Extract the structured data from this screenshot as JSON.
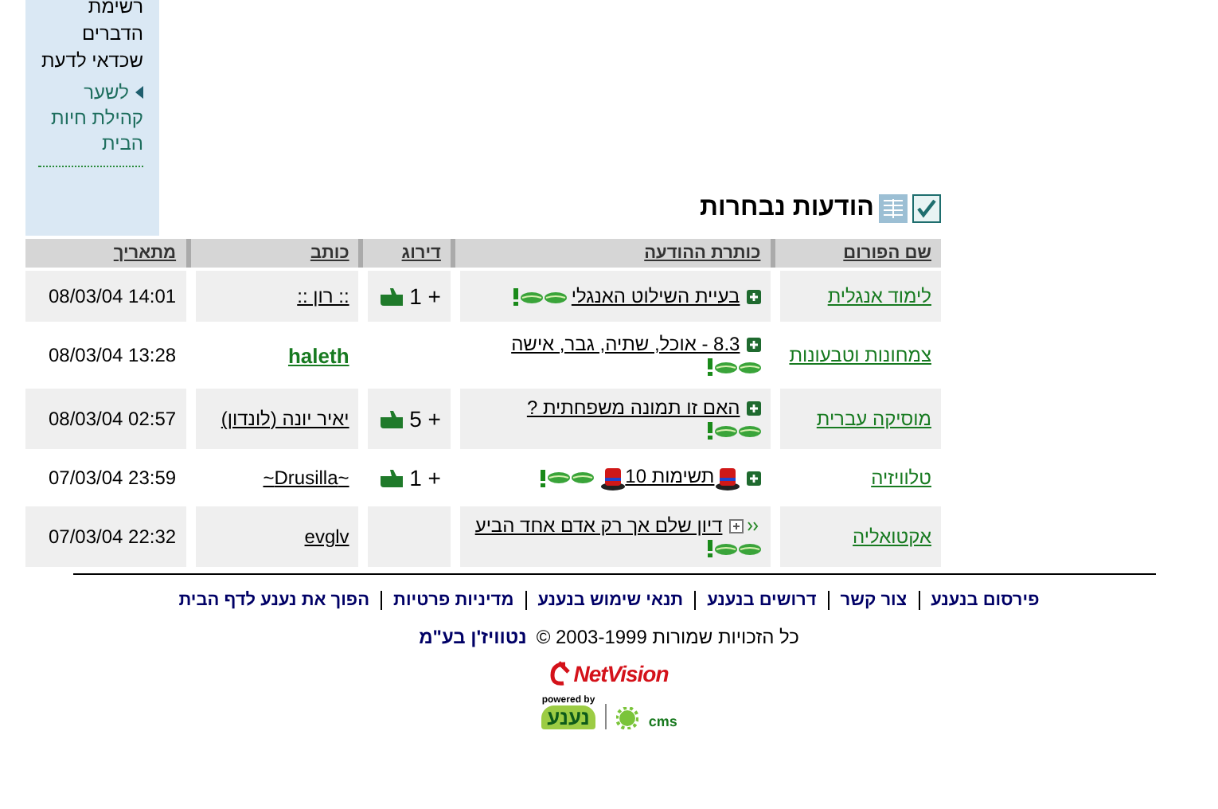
{
  "sidebar": {
    "text": "רשימת הדברים שכדאי לדעת",
    "link": "לשער קהילת חיות הבית"
  },
  "section_title": "הודעות נבחרות",
  "table": {
    "columns": [
      "שם הפורום",
      "כותרת ההודעה",
      "דירוג",
      "כותב",
      "מתאריך"
    ],
    "rows": [
      {
        "forum": "לימוד אנגלית",
        "kind": "plus",
        "title": "בעיית השילוט האנגלי",
        "hats": false,
        "icons": [
          {
            "kind": "leaf"
          },
          {
            "kind": "leaf"
          },
          {
            "kind": "exclamation"
          }
        ],
        "rating": "+ 1",
        "author": ":: רון ::",
        "author_bold": false,
        "date": "08/03/04 14:01"
      },
      {
        "forum": "צמחונות וטבעונות",
        "kind": "plus",
        "title": "8.3 - אוכל, שתיה, גבר, אישה",
        "hats": false,
        "icons": [
          {
            "kind": "leaf"
          },
          {
            "kind": "leaf"
          },
          {
            "kind": "exclamation"
          }
        ],
        "author": "haleth",
        "author_bold": true,
        "date": "08/03/04 13:28"
      },
      {
        "forum": "מוסיקה עברית",
        "kind": "plus",
        "title": "האם זו תמונה משפחתית ?",
        "hats": false,
        "icons": [
          {
            "kind": "leaf"
          },
          {
            "kind": "leaf"
          },
          {
            "kind": "exclamation"
          }
        ],
        "rating": "+ 5",
        "author": "יאיר יונה (לונדון)",
        "author_bold": false,
        "date": "08/03/04 02:57"
      },
      {
        "forum": "טלוויזיה",
        "kind": "plus",
        "title": "תשימות 10",
        "hats": true,
        "icons": [
          {
            "kind": "leaf"
          },
          {
            "kind": "leaf"
          },
          {
            "kind": "exclamation"
          }
        ],
        "rating": "+ 1",
        "author": "~Drusilla~",
        "author_bold": false,
        "date": "07/03/04 23:59"
      },
      {
        "forum": "אקטואליה",
        "kind": "box",
        "title": "דיון שלם אך רק אדם אחד הביע",
        "hats": false,
        "icons": [
          {
            "kind": "leaf"
          },
          {
            "kind": "leaf"
          },
          {
            "kind": "exclamation"
          }
        ],
        "author": "evglv",
        "author_bold": false,
        "date": "07/03/04 22:32"
      }
    ]
  },
  "footer": {
    "links": [
      "פירסום בנענע",
      "צור קשר",
      "דרושים בנענע",
      "תנאי שימוש בנענע",
      "מדיניות פרטיות",
      "הפוך את נענע לדף הבית"
    ],
    "copyright": "כל הזכויות שמורות 2003-1999 ©",
    "company": "נטוויז'ן בע\"מ",
    "logo": "NetVision",
    "powered_by": "powered by",
    "brand": "נענע",
    "cms": "cms"
  }
}
